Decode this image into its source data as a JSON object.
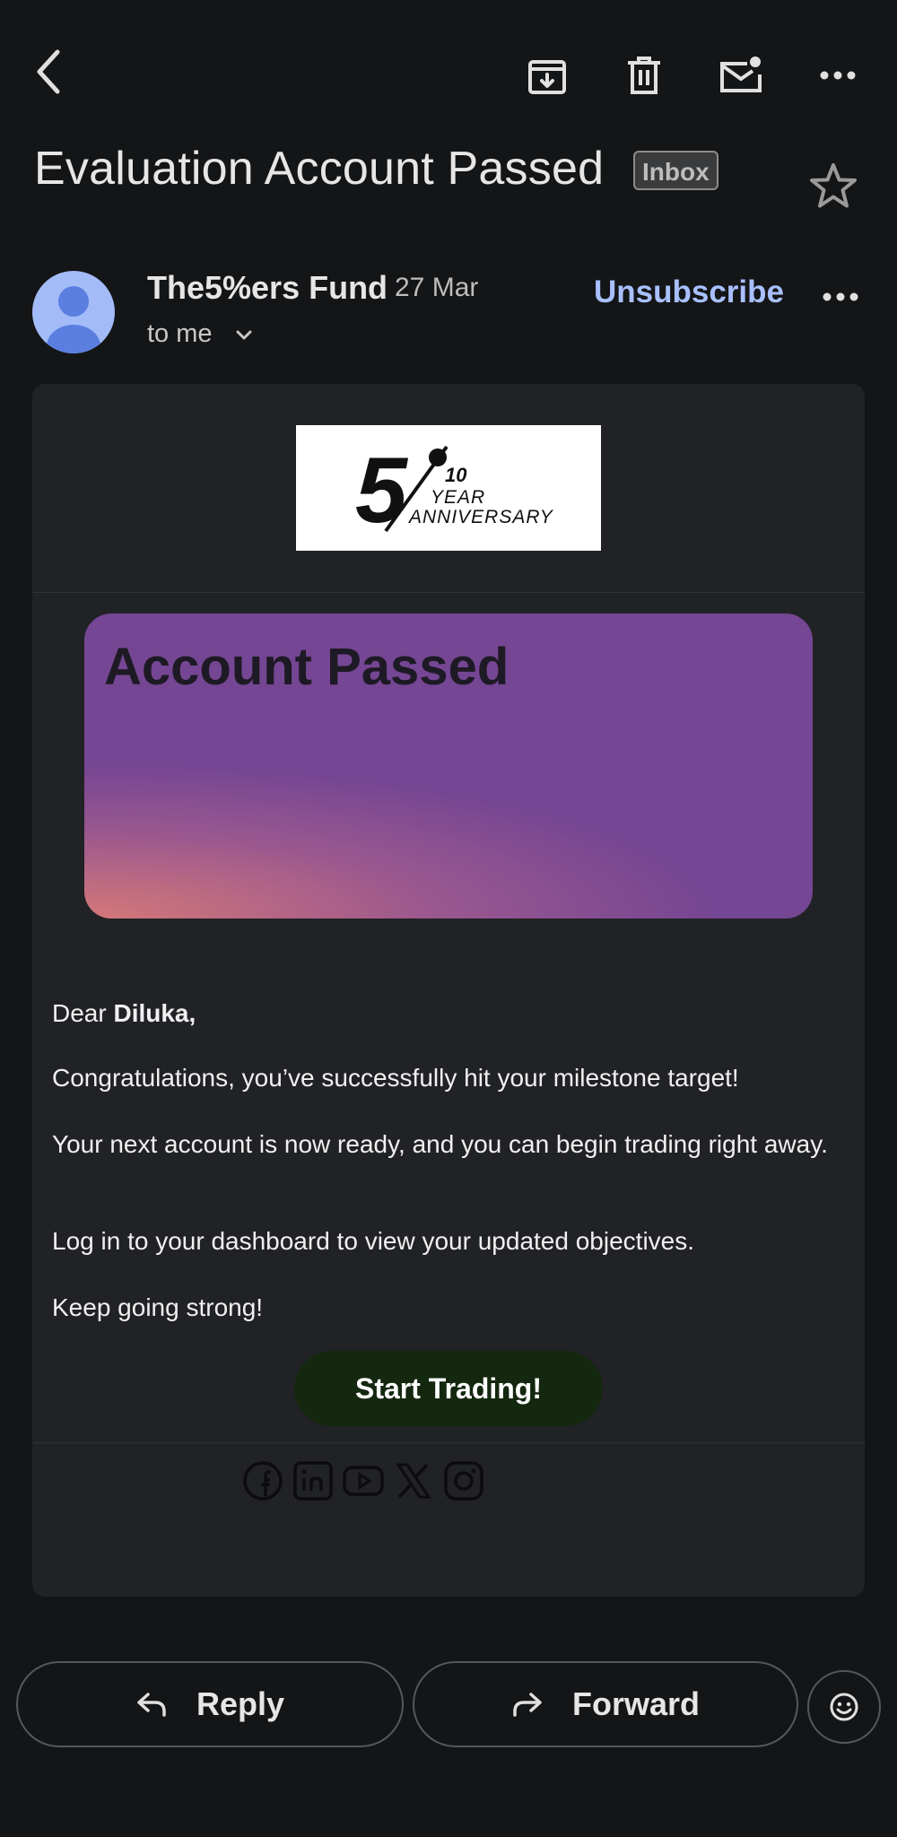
{
  "toolbar": {
    "back_icon": "chevron-left-icon",
    "archive_icon": "archive-icon",
    "delete_icon": "trash-icon",
    "mark_unread_icon": "mail-unread-icon",
    "more_icon": "more-horizontal-icon"
  },
  "email": {
    "subject": "Evaluation Account Passed",
    "label": "Inbox",
    "sender": "The5%ers Fund",
    "date": "27 Mar",
    "recipient": "to me",
    "unsubscribe": "Unsubscribe"
  },
  "content": {
    "logo": {
      "big": "5",
      "num": "10",
      "line1": "YEAR",
      "line2": "ANNIVERSARY"
    },
    "hero_title": "Account Passed",
    "greeting_prefix": "Dear ",
    "recipient_name": "Diluka,",
    "p1": "Congratulations, you’ve successfully hit your milestone target!",
    "p2": "Your next account is now ready, and you can begin trading right away.",
    "p3": "Log in to your dashboard to view your updated objectives.",
    "p4": "Keep going strong!",
    "cta": "Start Trading!",
    "social_icons": [
      "facebook-icon",
      "linkedin-icon",
      "youtube-icon",
      "x-icon",
      "instagram-icon"
    ]
  },
  "actions": {
    "reply": "Reply",
    "forward": "Forward",
    "emoji_icon": "smiley-icon"
  },
  "colors": {
    "background": "#141517",
    "card": "#212225",
    "accent_link": "#a8c0ff",
    "hero": "#754693",
    "cta": "#14270f"
  }
}
